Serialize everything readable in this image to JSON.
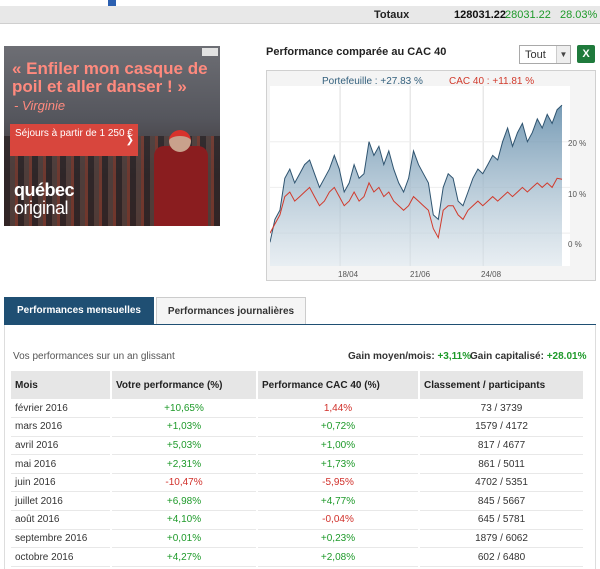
{
  "totals": {
    "label": "Totaux",
    "value": "128031.22",
    "gain": "28031.22",
    "pct": "28.03%"
  },
  "ad": {
    "quote": "« Enfiler mon casque de poil et aller danser ! »",
    "author": "- Virginie",
    "offer": "Séjours à partir de 1 250 €",
    "brand_line1": "québec",
    "brand_line2": "original"
  },
  "chart": {
    "title": "Performance comparée au CAC 40",
    "period_select": "Tout",
    "legend_portfolio": "Portefeuille : +27.83 %",
    "legend_cac": "CAC 40 : +11.81 %",
    "yticks": [
      "20 %",
      "10 %",
      "0 %"
    ],
    "xticks": [
      "18/04",
      "21/06",
      "24/08"
    ]
  },
  "chart_data": {
    "type": "area",
    "yticks": [
      "20 %",
      "10 %",
      "0 %"
    ],
    "xticks": [
      "18/04",
      "21/06",
      "24/08"
    ],
    "series": [
      {
        "name": "Portefeuille : +27.83 %",
        "color": "#5e89a8",
        "values": [
          -2,
          3,
          5,
          12,
          14,
          11,
          13,
          15,
          16,
          13,
          10,
          12,
          14,
          17,
          14,
          9,
          11,
          15,
          12,
          13,
          20,
          17,
          19,
          15,
          18,
          14,
          11,
          9,
          12,
          18,
          15,
          13,
          11,
          4,
          3,
          10,
          13,
          12,
          7,
          6,
          9,
          12,
          14,
          13,
          15,
          17,
          16,
          20,
          23,
          19,
          22,
          24,
          20,
          22,
          25,
          23,
          26,
          24,
          27,
          28
        ]
      },
      {
        "name": "CAC 40 : +11.81 %",
        "color": "#d13a2c",
        "values": [
          0,
          2,
          4,
          8,
          9,
          7,
          8,
          9,
          10,
          8,
          6,
          7,
          9,
          10,
          8,
          6,
          7,
          9,
          7,
          8,
          11,
          9,
          10,
          8,
          9,
          7,
          6,
          5,
          6,
          8,
          7,
          6,
          5,
          1,
          -1,
          5,
          6,
          6,
          4,
          3,
          5,
          6,
          7,
          6,
          7,
          8,
          7,
          8,
          9,
          8,
          9,
          10,
          9,
          10,
          11,
          10,
          11,
          10,
          12,
          11.8
        ]
      }
    ]
  },
  "tabs": {
    "monthly": "Performances mensuelles",
    "daily": "Performances journalières"
  },
  "panel": {
    "subhead": "Vos performances sur un an glissant",
    "gain_month_label": "Gain moyen/mois:",
    "gain_month_value": "+3,11%",
    "gain_cap_label": "Gain capitalisé:",
    "gain_cap_value": "+28.01%"
  },
  "table": {
    "headers": [
      "Mois",
      "Votre performance (%)",
      "Performance CAC 40 (%)",
      "Classement / participants"
    ],
    "rows": [
      {
        "month": "février 2016",
        "perf": "+10,65%",
        "cac": "1,44%",
        "rank": "73 / 3739"
      },
      {
        "month": "mars 2016",
        "perf": "+1,03%",
        "cac": "+0,72%",
        "rank": "1579 / 4172"
      },
      {
        "month": "avril 2016",
        "perf": "+5,03%",
        "cac": "+1,00%",
        "rank": "817 / 4677"
      },
      {
        "month": "mai 2016",
        "perf": "+2,31%",
        "cac": "+1,73%",
        "rank": "861 / 5011"
      },
      {
        "month": "juin 2016",
        "perf": "-10,47%",
        "cac": "-5,95%",
        "rank": "4702 / 5351"
      },
      {
        "month": "juillet 2016",
        "perf": "+6,98%",
        "cac": "+4,77%",
        "rank": "845 / 5667"
      },
      {
        "month": "août 2016",
        "perf": "+4,10%",
        "cac": "-0,04%",
        "rank": "645 / 5781"
      },
      {
        "month": "septembre 2016",
        "perf": "+0,01%",
        "cac": "+0,23%",
        "rank": "1879 / 6062"
      },
      {
        "month": "octobre 2016",
        "perf": "+4,27%",
        "cac": "+2,08%",
        "rank": "602 / 6480"
      }
    ]
  }
}
